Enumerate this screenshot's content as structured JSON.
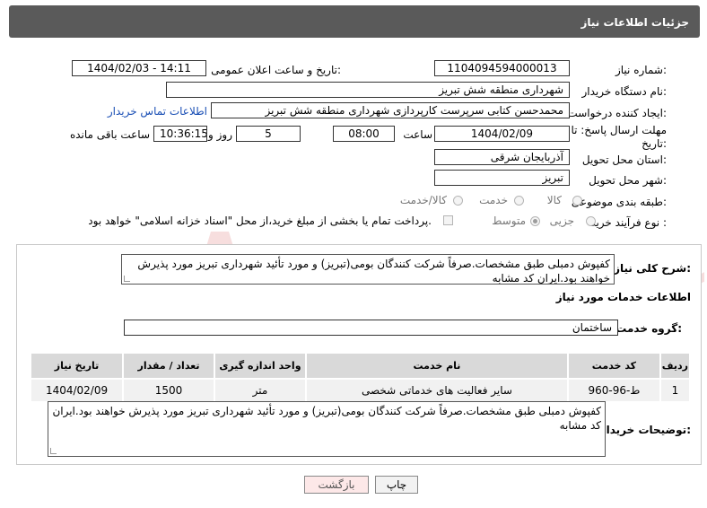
{
  "header": {
    "title": "جزئیات اطلاعات نیاز"
  },
  "form": {
    "need_number_label": "شماره نیاز:",
    "need_number": "1104094594000013",
    "announce_label": "تاریخ و ساعت اعلان عمومی:",
    "announce_value": "1404/02/03 - 14:11",
    "buyer_org_label": "نام دستگاه خریدار:",
    "buyer_org": "شهرداری منطقه شش تبریز",
    "requester_label": "ایجاد کننده درخواست:",
    "requester": "محمدحسن کتابی سرپرست کارپردازی شهرداری منطقه شش تبریز",
    "contact_link": "اطلاعات تماس خریدار",
    "deadline_label_1": "مهلت ارسال پاسخ: تا",
    "deadline_label_2": "تاریخ:",
    "deadline_date": "1404/02/09",
    "time_label": "ساعت",
    "deadline_time": "08:00",
    "days_value": "5",
    "days_label": "روز و",
    "remaining_time": "10:36:15",
    "remaining_label": "ساعت باقی مانده",
    "province_label": "استان محل تحویل:",
    "province": "آذربایجان شرقی",
    "city_label": "شهر محل تحویل:",
    "city": "تبریز",
    "category_label": "طبقه بندی موضوعی:",
    "category_options": [
      "کالا",
      "خدمت",
      "کالا/خدمت"
    ],
    "process_label": "نوع فرآیند خرید :",
    "process_options": [
      "جزیی",
      "متوسط"
    ],
    "payment_note": "پرداخت تمام یا بخشی از مبلغ خرید،از محل \"اسناد خزانه اسلامی\" خواهد بود."
  },
  "summary": {
    "label": "شرح کلی نیاز:",
    "text": "کفپوش دمبلی طبق مشخصات.صرفاً شرکت کنندگان بومی(تبریز) و مورد تأئید شهرداری تبریز مورد پذیرش خواهند بود.ایران کد مشابه"
  },
  "services": {
    "section_title": "اطلاعات خدمات مورد نیاز",
    "group_label": "گروه خدمت:",
    "group_value": "ساختمان",
    "columns": [
      "ردیف",
      "کد خدمت",
      "نام خدمت",
      "واحد اندازه گیری",
      "تعداد / مقدار",
      "تاریخ نیاز"
    ],
    "rows": [
      {
        "row": "1",
        "code": "ط-96-960",
        "name": "سایر فعالیت های خدماتی شخصی",
        "unit": "متر",
        "qty": "1500",
        "date": "1404/02/09"
      }
    ]
  },
  "buyer_notes": {
    "label": "توضیحات خریدار:",
    "text": "کفپوش دمبلی طبق مشخصات.صرفاً شرکت کنندگان بومی(تبریز) و مورد تأئید شهرداری تبریز مورد پذیرش خواهند بود.ایران کد مشابه"
  },
  "buttons": {
    "print": "چاپ",
    "back": "بازگشت"
  },
  "watermark": {
    "text": "AriaTender.net"
  }
}
